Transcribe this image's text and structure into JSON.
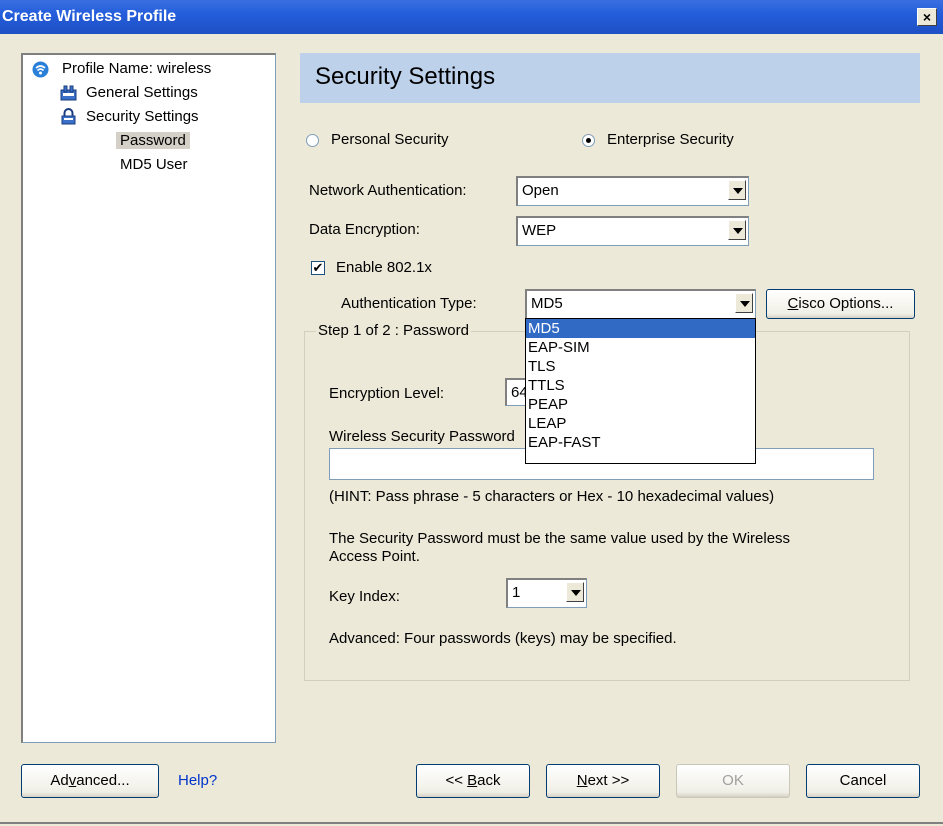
{
  "window": {
    "title": "Create Wireless Profile",
    "close_glyph": "×"
  },
  "tree": {
    "root": "Profile Name: wireless",
    "items": [
      "General Settings",
      "Security Settings"
    ],
    "sub_items": [
      "Password",
      "MD5 User"
    ]
  },
  "header": {
    "title": "Security Settings"
  },
  "security_mode": {
    "personal_label": "Personal Security",
    "enterprise_label": "Enterprise Security",
    "selected": "Enterprise Security"
  },
  "network_auth": {
    "label": "Network Authentication:",
    "value": "Open"
  },
  "data_encryption": {
    "label": "Data Encryption:",
    "value": "WEP"
  },
  "enable_8021x": {
    "label": "Enable 802.1x",
    "checked": true,
    "check_glyph": "✔"
  },
  "auth_type": {
    "label": "Authentication Type:",
    "value": "MD5",
    "options": [
      "MD5",
      "EAP-SIM",
      "TLS",
      "TTLS",
      "PEAP",
      "LEAP",
      "EAP-FAST"
    ]
  },
  "cisco_options": {
    "label_prefix": "",
    "accel": "C",
    "label_rest": "isco Options..."
  },
  "step": {
    "title": "Step 1 of 2 : Password"
  },
  "encryption_level": {
    "label": "Encryption Level:",
    "value_partial": "64"
  },
  "wireless_password": {
    "label": "Wireless Security Password",
    "value": ""
  },
  "hint": "(HINT: Pass phrase - 5 characters or Hex - 10 hexadecimal values)",
  "note_line1": "The Security Password must be the same value used by the Wireless",
  "note_line2": "Access Point.",
  "key_index": {
    "label": "Key Index:",
    "value": "1"
  },
  "advanced_note": "Advanced: Four passwords (keys) may be specified.",
  "footer": {
    "advanced": {
      "pre": "Ad",
      "accel": "v",
      "post": "anced..."
    },
    "help": "Help?",
    "back": {
      "pre": "<< ",
      "accel": "B",
      "post": "ack"
    },
    "next": {
      "pre": "",
      "accel": "N",
      "post": "ext >>"
    },
    "ok": "OK",
    "cancel": "Cancel"
  },
  "colors": {
    "title_bar": "#245edb",
    "header_band": "#bdd1ea",
    "highlight": "#316ac5",
    "link": "#0033cc"
  }
}
